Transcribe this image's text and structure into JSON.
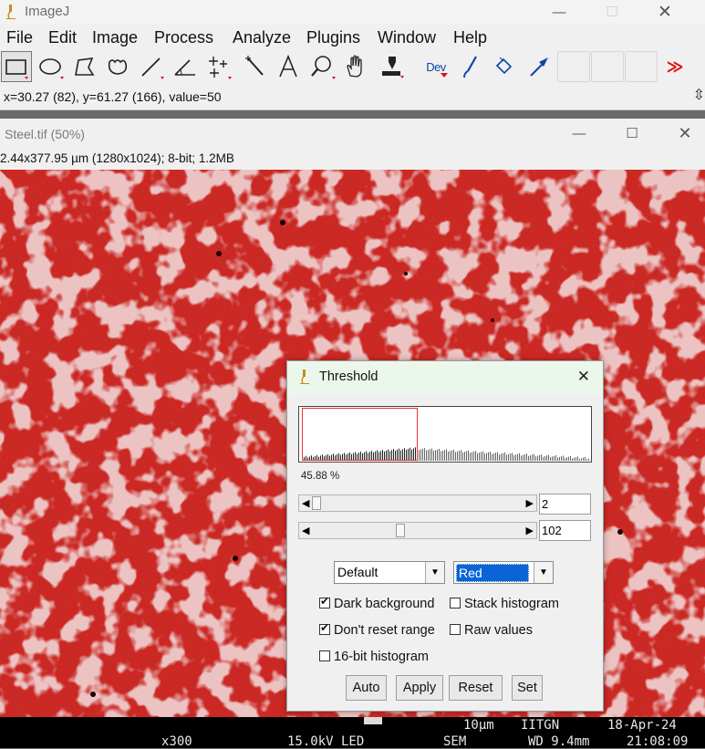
{
  "app": {
    "title": "ImageJ",
    "menus": [
      "File",
      "Edit",
      "Image",
      "Process",
      "Analyze",
      "Plugins",
      "Window",
      "Help"
    ],
    "toolbar": {
      "tools": [
        "rectangle-tool",
        "oval-tool",
        "polygon-tool",
        "freehand-tool",
        "line-tool",
        "angle-tool",
        "multipoint-tool",
        "wand-tool",
        "text-tool",
        "magnifier-tool",
        "scroll-tool",
        "color-picker-tool",
        "dev-menu-tool",
        "brush-tool",
        "flood-fill-tool",
        "arrow-tool"
      ],
      "dev_label": "Dev",
      "more_label": "≫"
    },
    "status": "x=30.27 (82), y=61.27 (166), value=50"
  },
  "image_window": {
    "title": "Steel.tif (50%)",
    "info": "2.44x377.95 µm (1280x1024); 8-bit; 1.2MB",
    "sem": {
      "scalebar": "10µm",
      "org": "IITGN",
      "date": "18-Apr-24",
      "mag": "x300",
      "kv": "15.0kV LED",
      "mode": "SEM",
      "wd": "WD 9.4mm",
      "time": "21:08:09"
    }
  },
  "threshold": {
    "title": "Threshold",
    "percent": "45.88 %",
    "min_value": "2",
    "max_value": "102",
    "min_fraction": 0.008,
    "max_fraction": 0.4,
    "method": "Default",
    "display_mode": "Red",
    "options": {
      "dark_background": {
        "label": "Dark background",
        "checked": true
      },
      "stack_histogram": {
        "label": "Stack histogram",
        "checked": false
      },
      "dont_reset": {
        "label": "Don't reset range",
        "checked": true
      },
      "raw_values": {
        "label": "Raw values",
        "checked": false
      },
      "bit16": {
        "label": "16-bit histogram",
        "checked": false
      }
    },
    "buttons": {
      "auto": "Auto",
      "apply": "Apply",
      "reset": "Reset",
      "set": "Set"
    }
  },
  "colors": {
    "threshold_red": "#d9211b",
    "selection": "#0a64d6"
  }
}
